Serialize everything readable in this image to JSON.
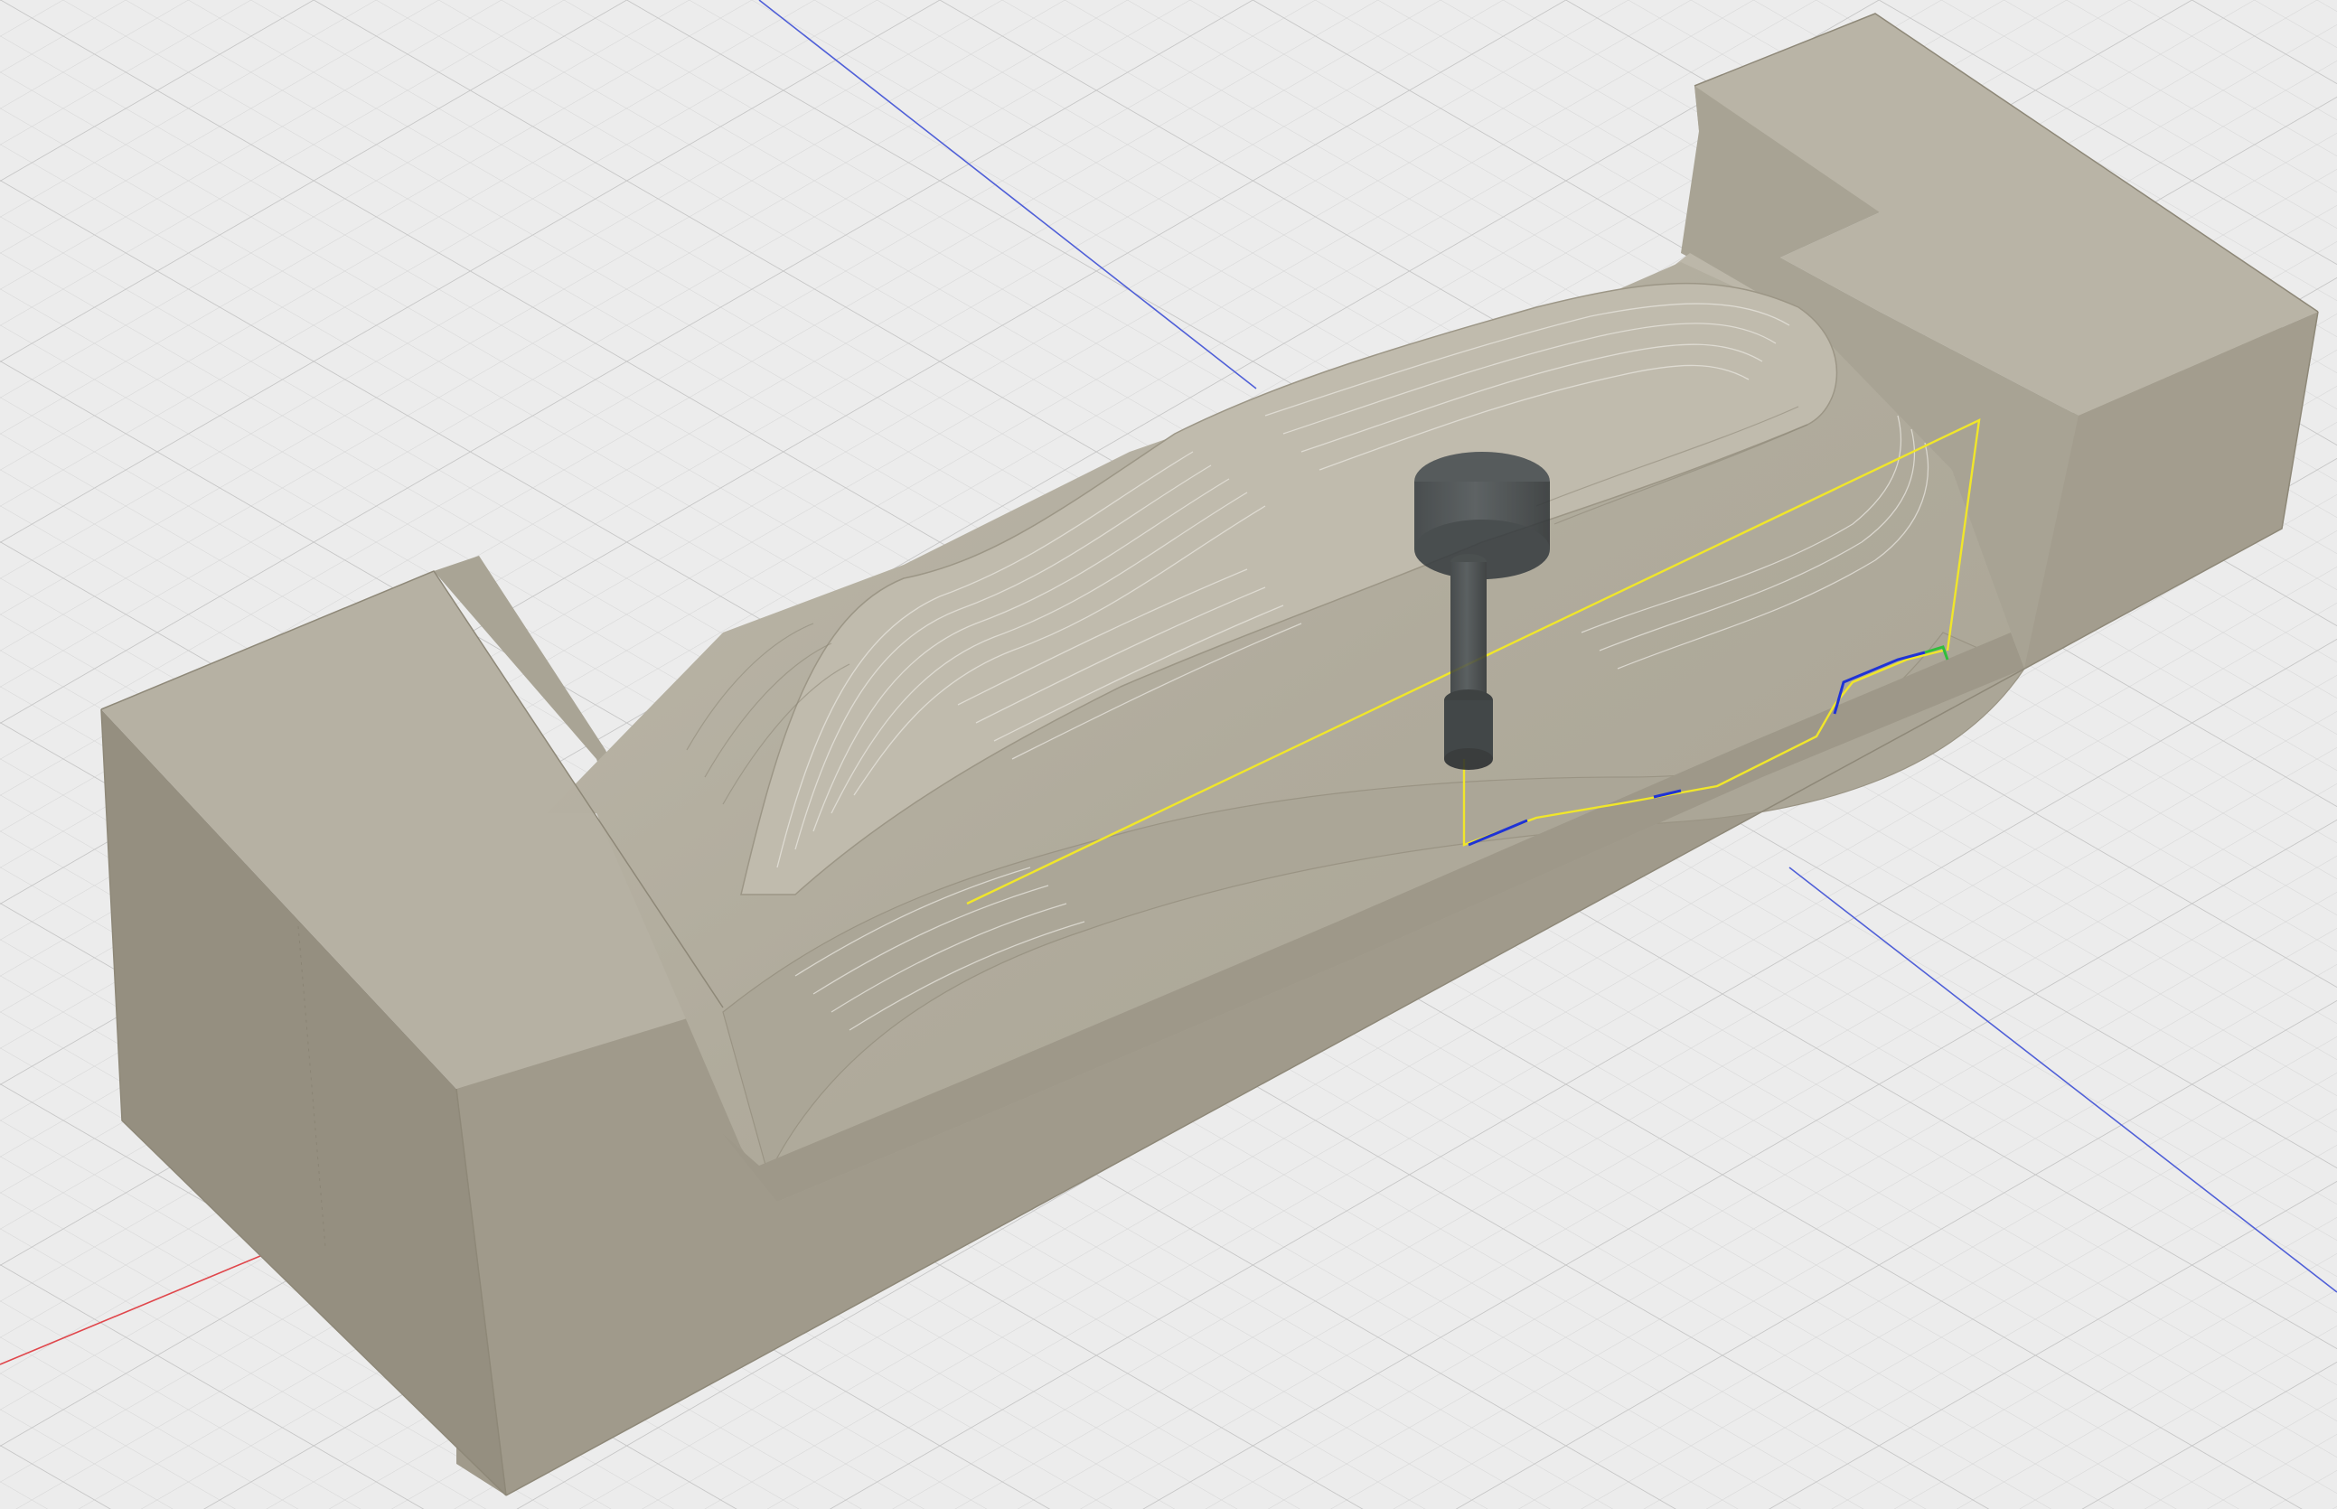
{
  "viewport": {
    "background_color": "#ececec",
    "grid_minor_color": "#dcdcdc",
    "grid_major_color": "#c8c8c8",
    "axis_x_color": "#e0474c",
    "axis_y_color": "#4a5bd8",
    "stock_color": "#b3aea0",
    "toolpath_color": "#f0e62a",
    "toolpath_link_color": "#1f33d6",
    "toolpath_end_color": "#2fbf3a",
    "tool_color": "#3d4347"
  },
  "icons": {
    "origin_marker": "origin-cube-icon"
  }
}
